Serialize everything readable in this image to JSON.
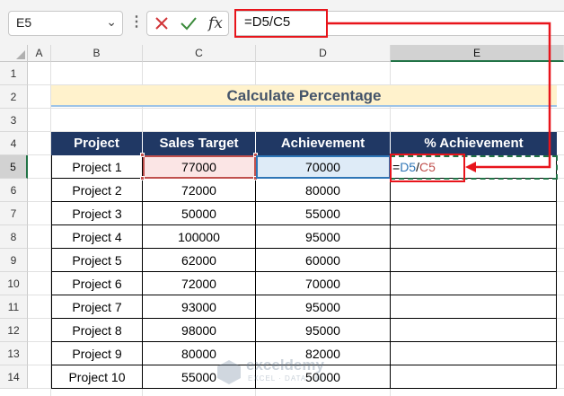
{
  "name_box": {
    "value": "E5"
  },
  "formula_bar": {
    "value": "=D5/C5",
    "cancel_icon": "cancel-icon",
    "enter_icon": "check-icon",
    "fx_label": "fx"
  },
  "columns": [
    "A",
    "B",
    "C",
    "D",
    "E"
  ],
  "rows": [
    "1",
    "2",
    "3",
    "4",
    "5",
    "6",
    "7",
    "8",
    "9",
    "10",
    "11",
    "12",
    "13",
    "14"
  ],
  "title": "Calculate Percentage",
  "table": {
    "headers": [
      "Project",
      "Sales Target",
      "Achievement",
      "% Achievement"
    ],
    "rows": [
      [
        "Project 1",
        "77000",
        "70000"
      ],
      [
        "Project 2",
        "72000",
        "80000"
      ],
      [
        "Project 3",
        "50000",
        "55000"
      ],
      [
        "Project 4",
        "100000",
        "95000"
      ],
      [
        "Project 5",
        "62000",
        "60000"
      ],
      [
        "Project 6",
        "72000",
        "70000"
      ],
      [
        "Project 7",
        "93000",
        "95000"
      ],
      [
        "Project 8",
        "98000",
        "95000"
      ],
      [
        "Project 9",
        "80000",
        "82000"
      ],
      [
        "Project 10",
        "55000",
        "50000"
      ]
    ]
  },
  "active_formula": {
    "eq": "=",
    "ref1": "D5",
    "slash": "/",
    "ref2": "C5"
  },
  "watermark": {
    "name": "exceldemy",
    "tagline": "EXCEL · DATA · BI"
  },
  "colors": {
    "header_bg": "#203864",
    "title_bg": "#fff2cc",
    "callout": "#e8141b",
    "ref_d": "#2e75b6",
    "ref_c": "#c0504d"
  }
}
